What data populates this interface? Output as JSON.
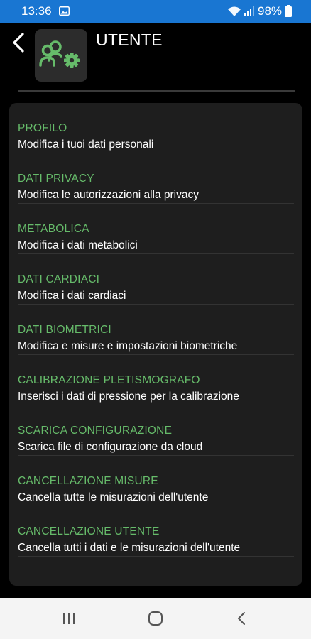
{
  "status_bar": {
    "time": "13:36",
    "battery": "98%"
  },
  "header": {
    "title": "UTENTE",
    "icon": "users-gear-icon"
  },
  "menu": {
    "items": [
      {
        "title": "PROFILO",
        "subtitle": "Modifica i tuoi dati personali"
      },
      {
        "title": "DATI PRIVACY",
        "subtitle": "Modifica le autorizzazioni alla privacy"
      },
      {
        "title": "METABOLICA",
        "subtitle": "Modifica i dati metabolici"
      },
      {
        "title": "DATI CARDIACI",
        "subtitle": "Modifica i dati cardiaci"
      },
      {
        "title": "DATI BIOMETRICI",
        "subtitle": "Modifica e misure e impostazioni biometriche"
      },
      {
        "title": "CALIBRAZIONE PLETISMOGRAFO",
        "subtitle": "Inserisci i dati di pressione per la calibrazione"
      },
      {
        "title": "SCARICA CONFIGURAZIONE",
        "subtitle": "Scarica file di configurazione da cloud"
      },
      {
        "title": "CANCELLAZIONE MISURE",
        "subtitle": "Cancella tutte le misurazioni dell'utente"
      },
      {
        "title": "CANCELLAZIONE UTENTE",
        "subtitle": "Cancella tutti i dati e le misurazioni dell'utente"
      }
    ]
  },
  "colors": {
    "status_bar": "#1976d2",
    "accent_green": "#66bb6a",
    "card_bg": "#1e1e1e",
    "background": "#000000"
  }
}
